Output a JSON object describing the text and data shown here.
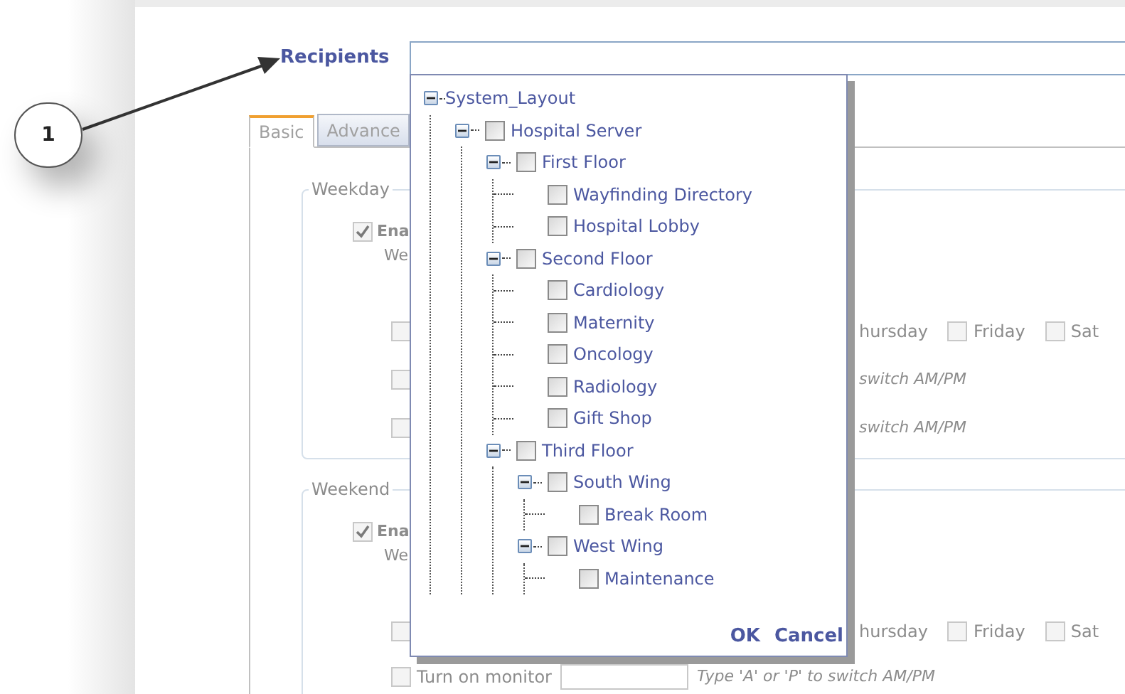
{
  "callout": {
    "number": "1"
  },
  "recipients": {
    "label": "Recipients"
  },
  "schedule_tabs": [
    {
      "label": "Basic",
      "selected": true
    },
    {
      "label": "Advance",
      "selected": false
    }
  ],
  "sections": [
    {
      "legend": "Weekday",
      "enable": {
        "label": "Ena",
        "checked": true
      },
      "enable_sub": "We",
      "rows": [
        {
          "kind": "days",
          "checked": false,
          "items": [
            {
              "label": "hursday"
            },
            {
              "label": "Friday",
              "checked": false
            },
            {
              "label": "Sat",
              "checked": false
            }
          ]
        },
        {
          "kind": "time",
          "checked": false,
          "hint": "switch AM/PM"
        },
        {
          "kind": "time",
          "checked": false,
          "hint": "switch AM/PM"
        }
      ]
    },
    {
      "legend": "Weekend",
      "enable": {
        "label": "Ena",
        "checked": true
      },
      "enable_sub": "We",
      "rows": [
        {
          "kind": "days",
          "checked": false,
          "items": [
            {
              "label": "hursday"
            },
            {
              "label": "Friday",
              "checked": false
            },
            {
              "label": "Sat",
              "checked": false
            }
          ]
        },
        {
          "kind": "monitor",
          "checked": false,
          "label": "Turn on monitor",
          "hint": "Type 'A' or 'P' to switch AM/PM"
        }
      ]
    }
  ],
  "tree": {
    "label": "System_Layout",
    "expanded": true,
    "children": [
      {
        "label": "Hospital Server",
        "checked": false,
        "expanded": true,
        "children": [
          {
            "label": "First Floor",
            "checked": false,
            "expanded": true,
            "children": [
              {
                "label": "Wayfinding Directory",
                "checked": false
              },
              {
                "label": "Hospital Lobby",
                "checked": false
              }
            ]
          },
          {
            "label": "Second Floor",
            "checked": false,
            "expanded": true,
            "children": [
              {
                "label": "Cardiology",
                "checked": false
              },
              {
                "label": "Maternity",
                "checked": false
              },
              {
                "label": "Oncology",
                "checked": false
              },
              {
                "label": "Radiology",
                "checked": false
              },
              {
                "label": "Gift Shop",
                "checked": false
              }
            ]
          },
          {
            "label": "Third Floor",
            "checked": false,
            "expanded": true,
            "children": [
              {
                "label": "South Wing",
                "checked": false,
                "expanded": true,
                "children": [
                  {
                    "label": "Break Room",
                    "checked": false
                  }
                ]
              },
              {
                "label": "West Wing",
                "checked": false,
                "expanded": true,
                "children": [
                  {
                    "label": "Maintenance",
                    "checked": false
                  }
                ]
              }
            ]
          }
        ]
      }
    ]
  },
  "popup_buttons": [
    "OK",
    "Cancel"
  ]
}
